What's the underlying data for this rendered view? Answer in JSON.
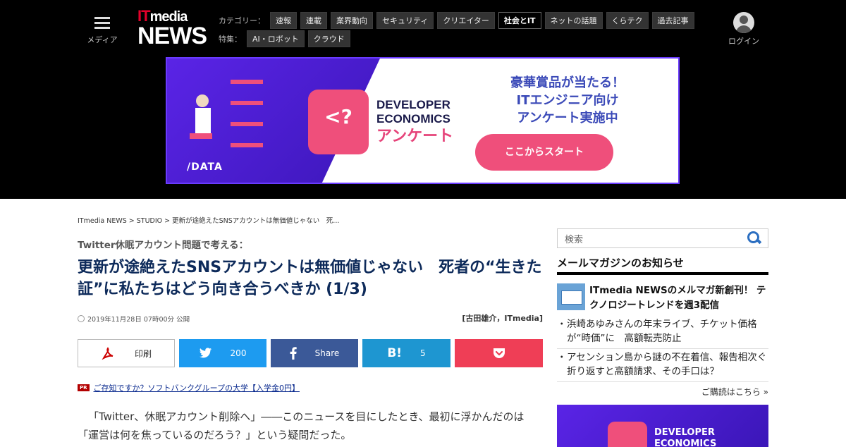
{
  "header": {
    "menu_label": "メディア",
    "logo_top": "ITmedia",
    "logo_it": "IT",
    "logo_media": "media",
    "logo_news": "NEWS",
    "category_label": "カテゴリー：",
    "categories": [
      "速報",
      "連載",
      "業界動向",
      "セキュリティ",
      "クリエイター",
      "社会とIT",
      "ネットの話題",
      "くらテク",
      "過去記事"
    ],
    "active_category": "社会とIT",
    "feature_label": "特集：",
    "features": [
      "AI・ロボット",
      "クラウド"
    ],
    "login_label": "ログイン"
  },
  "banner": {
    "brand_line1": "DEVELOPER",
    "brand_line2": "ECONOMICS",
    "brand_line3": "アンケート",
    "headline1": "豪華賞品が当たる！",
    "headline2": "ITエンジニア向け",
    "headline3": "アンケート実施中",
    "cta": "ここからスタート",
    "logo_symbol": "<?",
    "sponsor": "/DATA"
  },
  "article": {
    "breadcrumb": "ITmedia NEWS > STUDIO > 更新が途絶えたSNSアカウントは無価値じゃない　死...",
    "kicker": "Twitter休眠アカウント問題で考える：",
    "title": "更新が途絶えたSNSアカウントは無価値じゃない　死者の“生きた証”に私たちはどう向き合うべきか (1/3)",
    "date": "2019年11月28日 07時00分 公開",
    "author": "[古田雄介，ITmedia]",
    "share": {
      "print": "印刷",
      "twitter_count": "200",
      "facebook_label": "Share",
      "hatena_symbol": "B!",
      "hatena_count": "5"
    },
    "pr_badge": "PR",
    "pr_text": "ご存知ですか？ソフトバンクグループの大学【入学金0円】",
    "body": "「Twitter、休眠アカウント削除へ」――このニュースを目にしたとき、最初に浮かんだのは「運営は何を焦っているのだろう？」という疑問だった。"
  },
  "sidebar": {
    "search_placeholder": "検索",
    "mm_heading": "メールマガジンのお知らせ",
    "mm_featured": "ITmedia NEWSのメルマガ新創刊！ テクノロジートレンドを週3配信",
    "mm_items": [
      "浜崎あゆみさんの年末ライブ、チケット価格が“時価”に　高額転売防止",
      "アセンション島から謎の不在着信、報告相次ぐ　折り返すと高額請求、その手口は？"
    ],
    "mm_more": "ご購読はこちら »",
    "ad_line1": "DEVELOPER",
    "ad_line2": "ECONOMICS"
  },
  "colors": {
    "header_bg": "#000000",
    "title_color": "#0d2a5a",
    "twitter": "#1d9bf0",
    "facebook": "#3b5998",
    "hatena": "#1e96d1",
    "pocket": "#ef3e56",
    "banner_purple": "#5a24e6",
    "banner_pink": "#ef4f7b"
  }
}
